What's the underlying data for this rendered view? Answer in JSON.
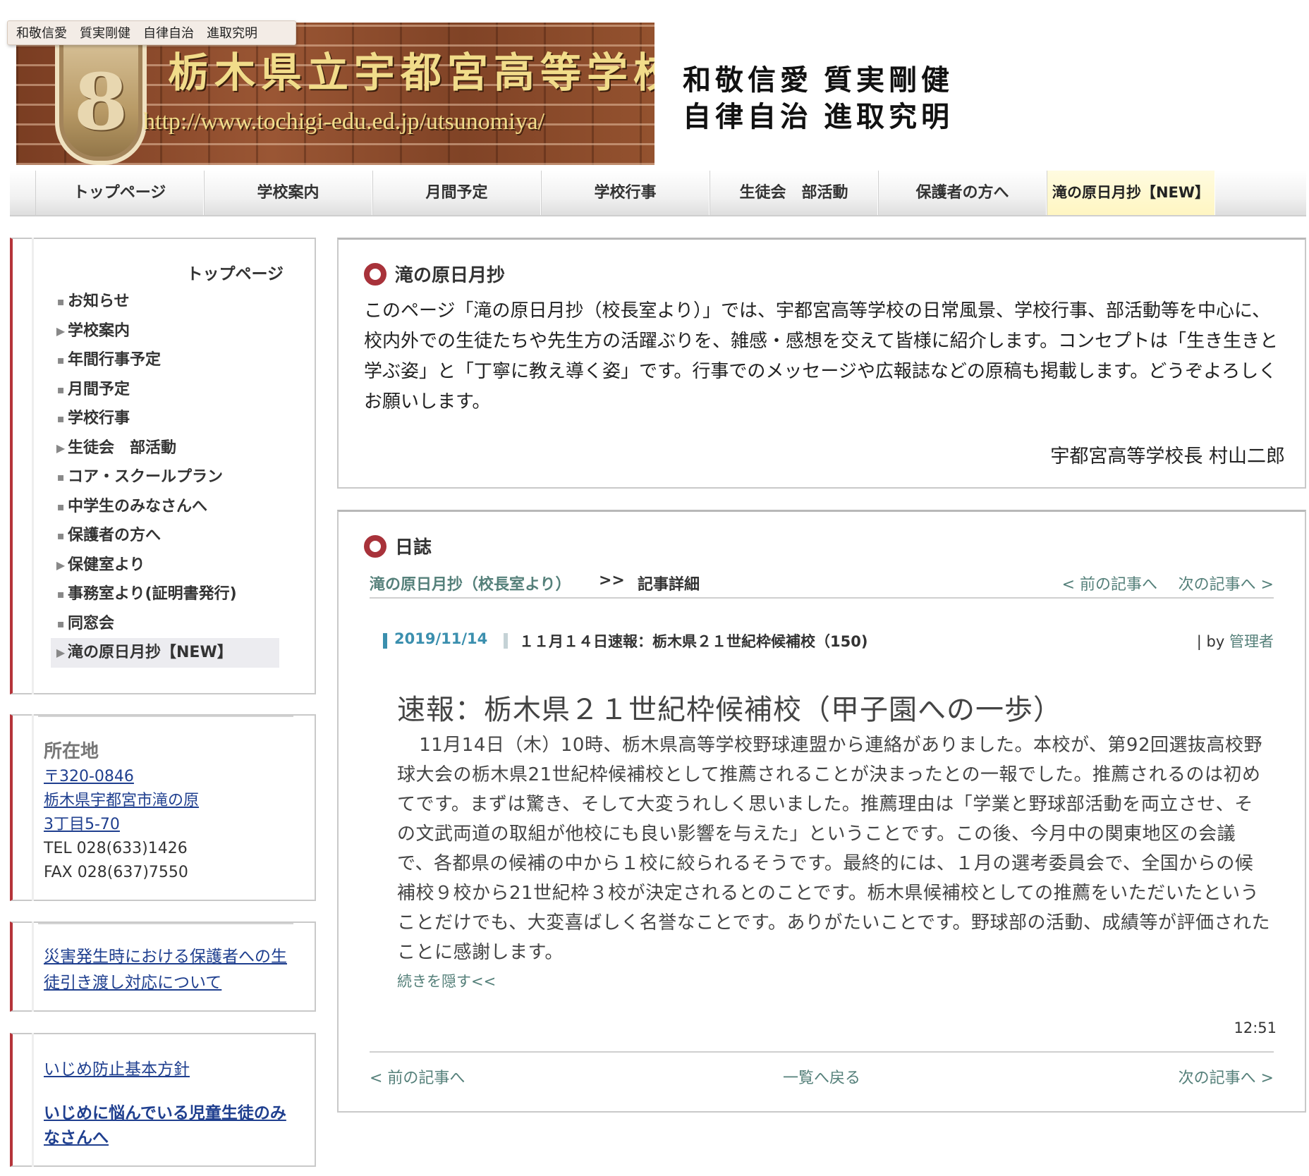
{
  "header": {
    "motto_tooltip": "和敬信愛　質実剛健　自律自治　進取究明",
    "banner_title": "栃木県立宇都宮高等学校",
    "banner_url": "http://www.tochigi-edu.ed.jp/utsunomiya/",
    "crest_mark": "8",
    "motto": [
      "和敬信愛",
      "質実剛健",
      "自律自治",
      "進取究明"
    ]
  },
  "nav": {
    "items": [
      "トップページ",
      "学校案内",
      "月間予定",
      "学校行事",
      "生徒会　部活動",
      "保護者の方へ",
      "滝の原日月抄【NEW】"
    ],
    "active_index": 6
  },
  "sidebar": {
    "menu_title": "トップページ",
    "items": [
      {
        "label": "お知らせ",
        "marker": "bullet"
      },
      {
        "label": "学校案内",
        "marker": "arrow"
      },
      {
        "label": "年間行事予定",
        "marker": "bullet"
      },
      {
        "label": "月間予定",
        "marker": "bullet"
      },
      {
        "label": "学校行事",
        "marker": "bullet"
      },
      {
        "label": "生徒会　部活動",
        "marker": "arrow"
      },
      {
        "label": "コア・スクールプラン",
        "marker": "bullet"
      },
      {
        "label": "中学生のみなさんへ",
        "marker": "bullet"
      },
      {
        "label": "保護者の方へ",
        "marker": "bullet"
      },
      {
        "label": "保健室より",
        "marker": "arrow"
      },
      {
        "label": "事務室より(証明書発行)",
        "marker": "bullet"
      },
      {
        "label": "同窓会",
        "marker": "bullet"
      },
      {
        "label": "滝の原日月抄【NEW】",
        "marker": "arrow",
        "current": true
      }
    ],
    "address": {
      "title": "所在地",
      "postal": "〒320-0846",
      "line1": "栃木県宇都宮市滝の原",
      "line2": "3丁目5-70",
      "tel": "TEL 028(633)1426",
      "fax": "FAX 028(637)7550"
    },
    "disaster_link": "災害発生時における保護者への生徒引き渡し対応について",
    "bullying_policy_link": "いじめ防止基本方針",
    "bullying_help_link": "いじめに悩んでいる児童生徒のみなさんへ"
  },
  "intro": {
    "title": "滝の原日月抄",
    "text": "このページ「滝の原日月抄（校長室より）」では、宇都宮高等学校の日常風景、学校行事、部活動等を中心に、校内外での生徒たちや先生方の活躍ぶりを、雑感・感想を交えて皆様に紹介します。コンセプトは「生き生きと学ぶ姿」と「丁寧に教え導く姿」です。行事でのメッセージや広報誌などの原稿も掲載します。どうぞよろしくお願いします。",
    "signature": "宇都宮高等学校長 村山二郎"
  },
  "diary": {
    "title": "日誌",
    "breadcrumb_home": "滝の原日月抄（校長室より）",
    "breadcrumb_sep": ">>",
    "breadcrumb_current": "記事詳細",
    "prev_label": "< 前の記事へ",
    "next_label": "次の記事へ >",
    "entry": {
      "date": "2019/11/14",
      "category": "１１月１４日速報：栃木県２１世紀枠候補校（150)",
      "by_prefix": "| by",
      "author": "管理者",
      "title": "速報：栃木県２１世紀枠候補校（甲子園への一歩）",
      "body": "11月14日（木）10時、栃木県高等学校野球連盟から連絡がありました。本校が、第92回選抜高校野球大会の栃木県21世紀枠候補校として推薦されることが決まったとの一報でした。推薦されるのは初めてです。まずは驚き、そして大変うれしく思いました。推薦理由は「学業と野球部活動を両立させ、その文武両道の取組が他校にも良い影響を与えた」ということです。この後、今月中の関東地区の会議で、各都県の候補の中から１校に絞られるそうです。最終的には、１月の選考委員会で、全国からの候補校９校から21世紀枠３校が決定されるとのことです。栃木県候補校としての推薦をいただいたということだけでも、大変喜ばしく名誉なことです。ありがたいことです。野球部の活動、成績等が評価されたことに感謝します。",
      "collapse_label": "続きを隠す<<",
      "time": "12:51"
    },
    "footer_prev": "< 前の記事へ",
    "footer_list": "一覧へ戻る",
    "footer_next": "次の記事へ >"
  },
  "colors": {
    "accent_red": "#a8323a",
    "link_teal": "#55807a",
    "date_blue": "#3b8fae",
    "nav_active_bg": "#fff6c2"
  }
}
